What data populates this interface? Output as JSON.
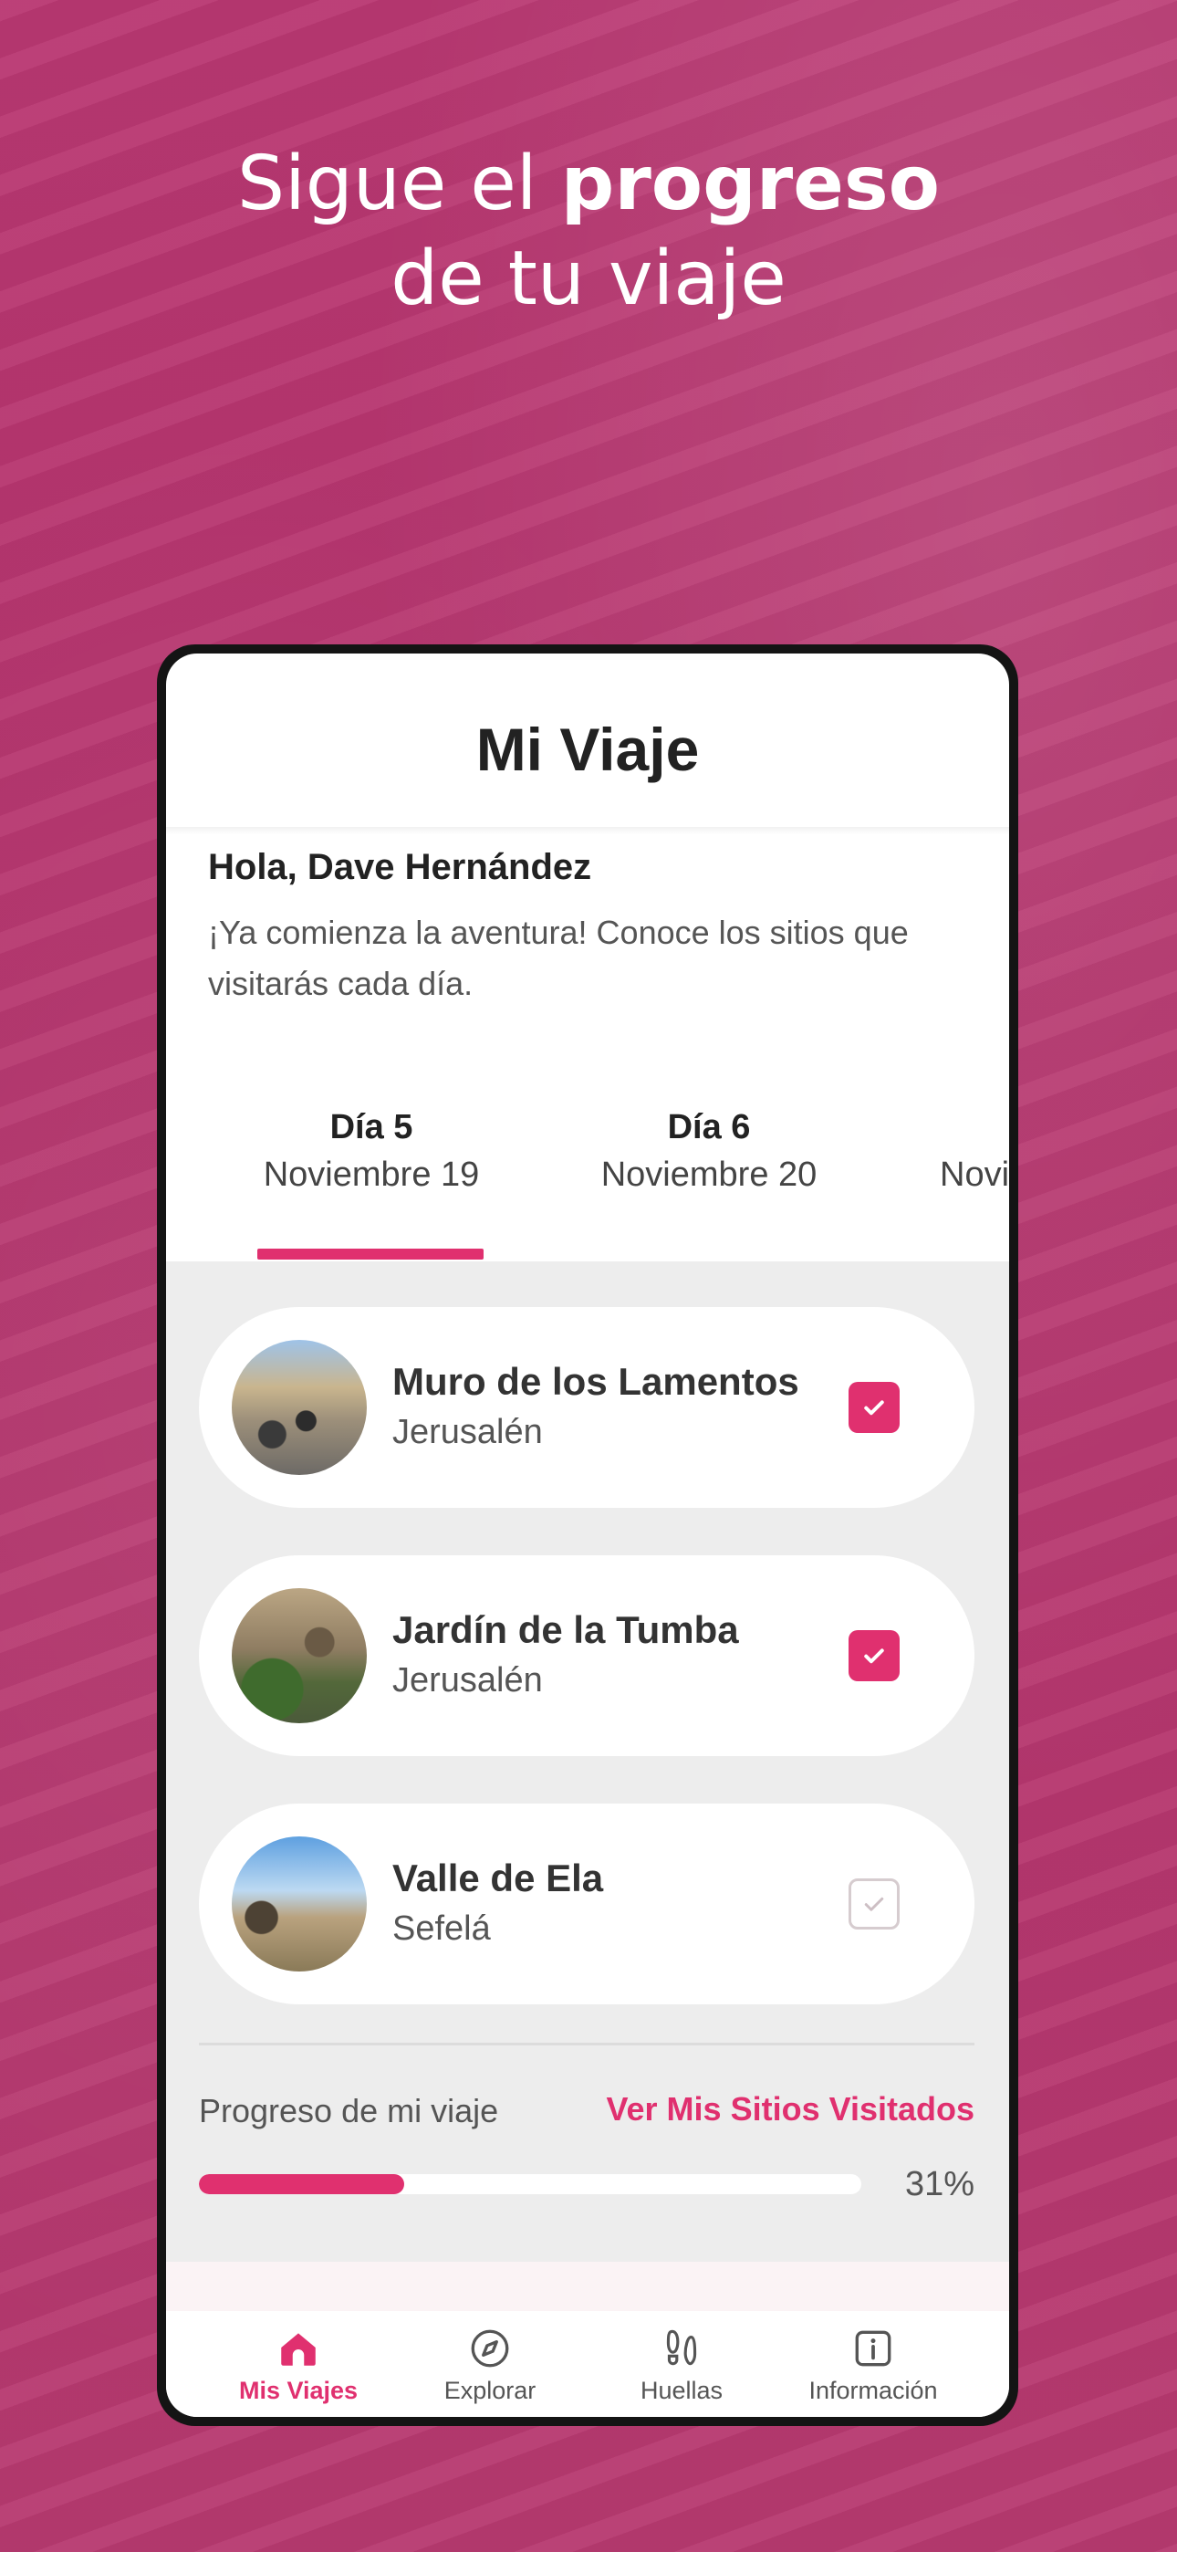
{
  "promo": {
    "headline_line1_regular": "Sigue el ",
    "headline_line1_bold": "progreso",
    "headline_line2": "de tu viaje"
  },
  "app": {
    "title": "Mi Viaje",
    "greeting": "Hola, Dave Hernández",
    "subtitle": "¡Ya comienza la aventura! Conoce los sitios que visitarás cada día.",
    "days": [
      {
        "day": "Día 5",
        "date": "Noviembre 19",
        "selected": true
      },
      {
        "day": "Día 6",
        "date": "Noviembre 20",
        "selected": false
      },
      {
        "day": "",
        "date": "Novi",
        "selected": false
      }
    ],
    "places": [
      {
        "name": "Muro de los Lamentos",
        "city": "Jerusalén",
        "visited": true
      },
      {
        "name": "Jardín de la Tumba",
        "city": "Jerusalén",
        "visited": true
      },
      {
        "name": "Valle de Ela",
        "city": "Sefelá",
        "visited": false
      }
    ],
    "progress": {
      "label": "Progreso de mi viaje",
      "link": "Ver Mis Sitios Visitados",
      "percent_text": "31%",
      "value": 0.31
    },
    "tabs": [
      {
        "label": "Mis Viajes",
        "icon": "home-icon",
        "active": true
      },
      {
        "label": "Explorar",
        "icon": "compass-icon",
        "active": false
      },
      {
        "label": "Huellas",
        "icon": "footprints-icon",
        "active": false
      },
      {
        "label": "Información",
        "icon": "info-icon",
        "active": false
      }
    ]
  },
  "colors": {
    "accent": "#e0306f",
    "background": "#b8336e"
  }
}
